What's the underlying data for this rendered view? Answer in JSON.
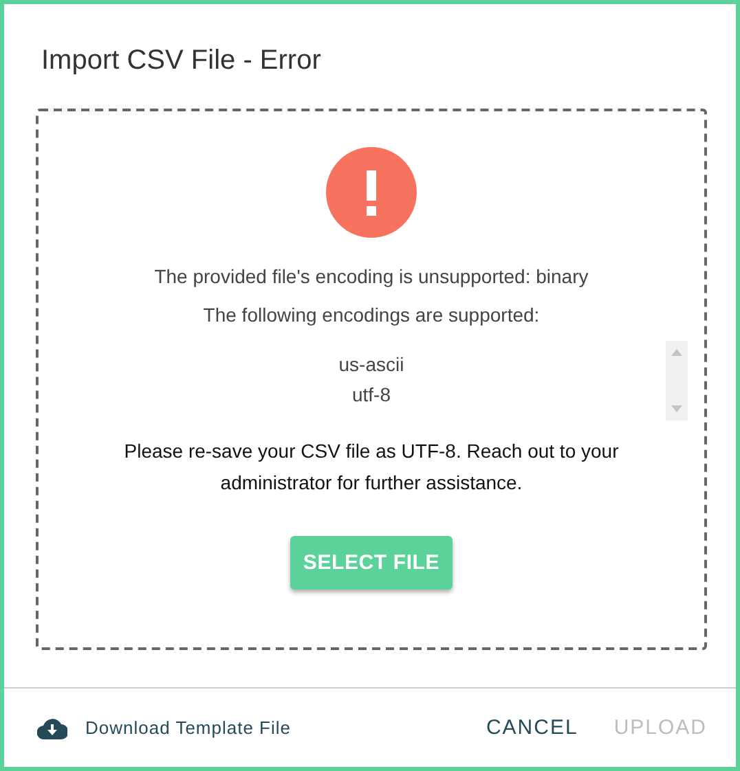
{
  "dialog": {
    "title": "Import CSV File - Error"
  },
  "error": {
    "message": "The provided file's encoding is unsupported: binary",
    "supported_label": "The following encodings are supported:",
    "encodings": [
      "us-ascii",
      "utf-8"
    ],
    "advice": "Please re-save your CSV file as UTF-8. Reach out to your administrator for further assistance.",
    "select_button": "SELECT FILE"
  },
  "footer": {
    "download_link": "Download Template File",
    "buttons": [
      {
        "label": "CANCEL",
        "disabled": false
      },
      {
        "label": "UPLOAD",
        "disabled": true
      }
    ]
  }
}
